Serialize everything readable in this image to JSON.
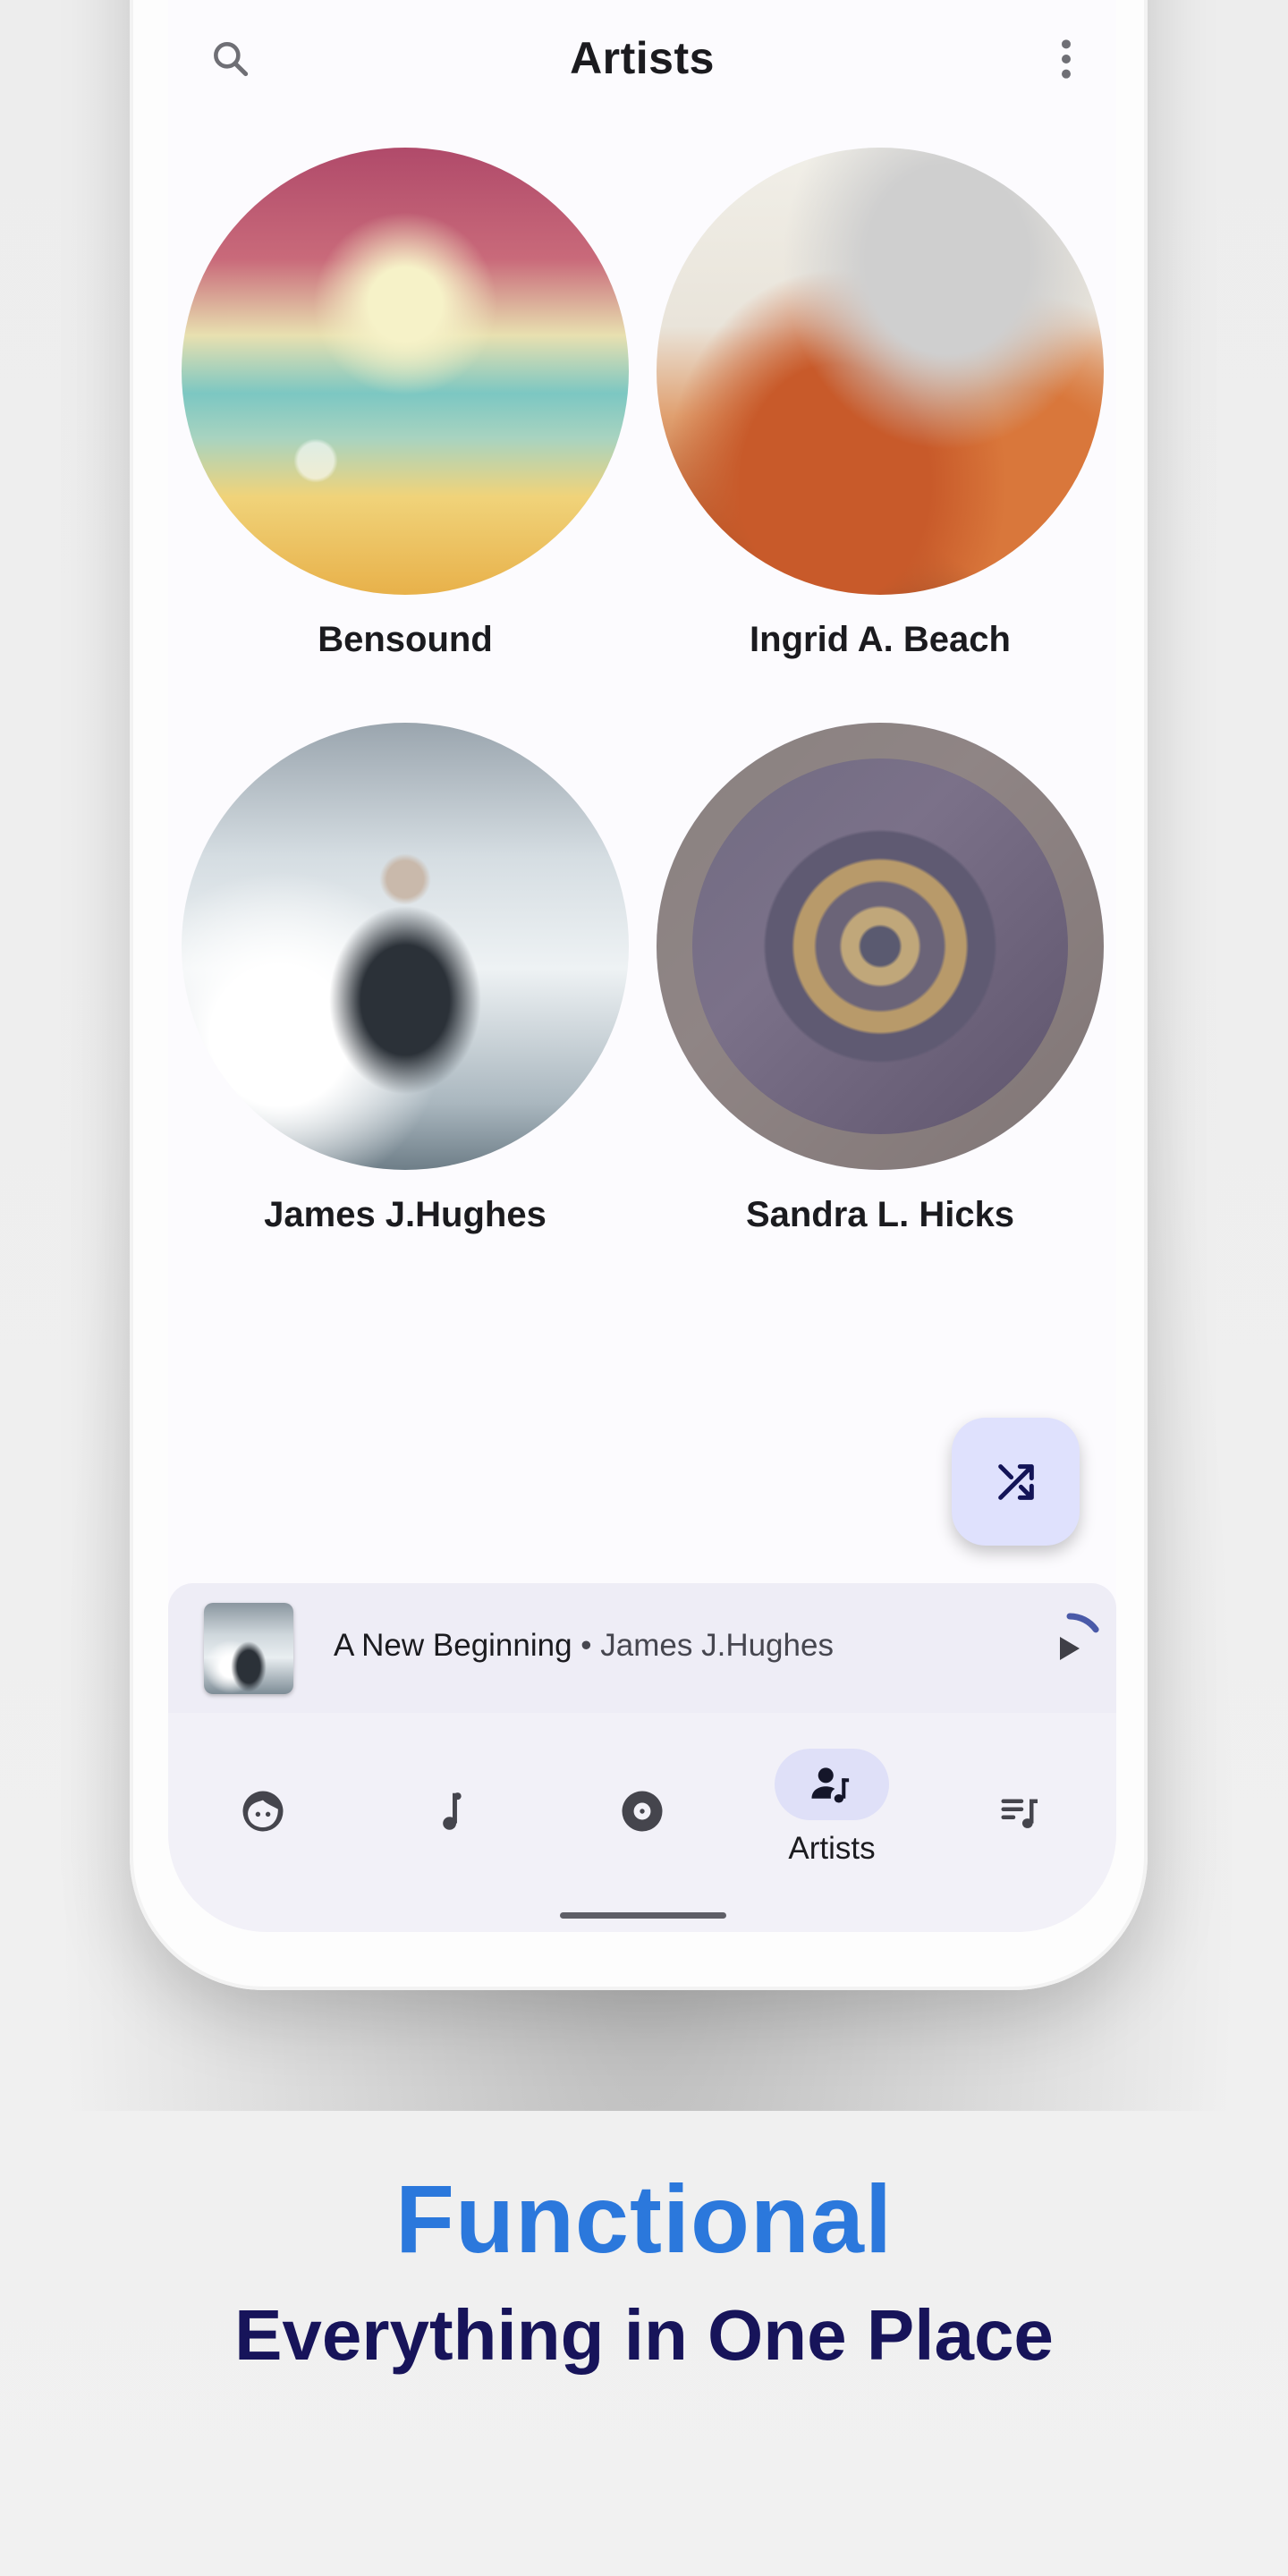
{
  "header": {
    "title": "Artists",
    "search_icon": "search-icon",
    "menu_icon": "more-vert-icon"
  },
  "artists": [
    {
      "name": "Bensound",
      "art": "beach-heart-hands"
    },
    {
      "name": "Ingrid A. Beach",
      "art": "carousel-horses"
    },
    {
      "name": "James J.Hughes",
      "art": "woman-in-snow"
    },
    {
      "name": "Sandra L. Hicks",
      "art": "manhole-cover"
    }
  ],
  "fab": {
    "icon": "shuffle-icon",
    "label": "Shuffle"
  },
  "mini_player": {
    "song": "A New Beginning",
    "separator": " • ",
    "artist": "James J.Hughes",
    "play_icon": "play-icon",
    "progress": 0.15
  },
  "nav": {
    "items": [
      {
        "id": "for-you",
        "icon": "face-icon",
        "label": ""
      },
      {
        "id": "songs",
        "icon": "music-note-icon",
        "label": ""
      },
      {
        "id": "albums",
        "icon": "album-icon",
        "label": ""
      },
      {
        "id": "artists",
        "icon": "artist-icon",
        "label": "Artists",
        "active": true
      },
      {
        "id": "playlists",
        "icon": "playlist-icon",
        "label": ""
      }
    ]
  },
  "tagline": {
    "headline": "Functional",
    "subhead": "Everything in One Place"
  },
  "colors": {
    "accent_blue": "#2b78dc",
    "navy": "#17145a",
    "fab_bg": "#dfe1fd",
    "nav_active_pill": "#dfe0f8",
    "progress_arc": "#4a5aa8"
  }
}
